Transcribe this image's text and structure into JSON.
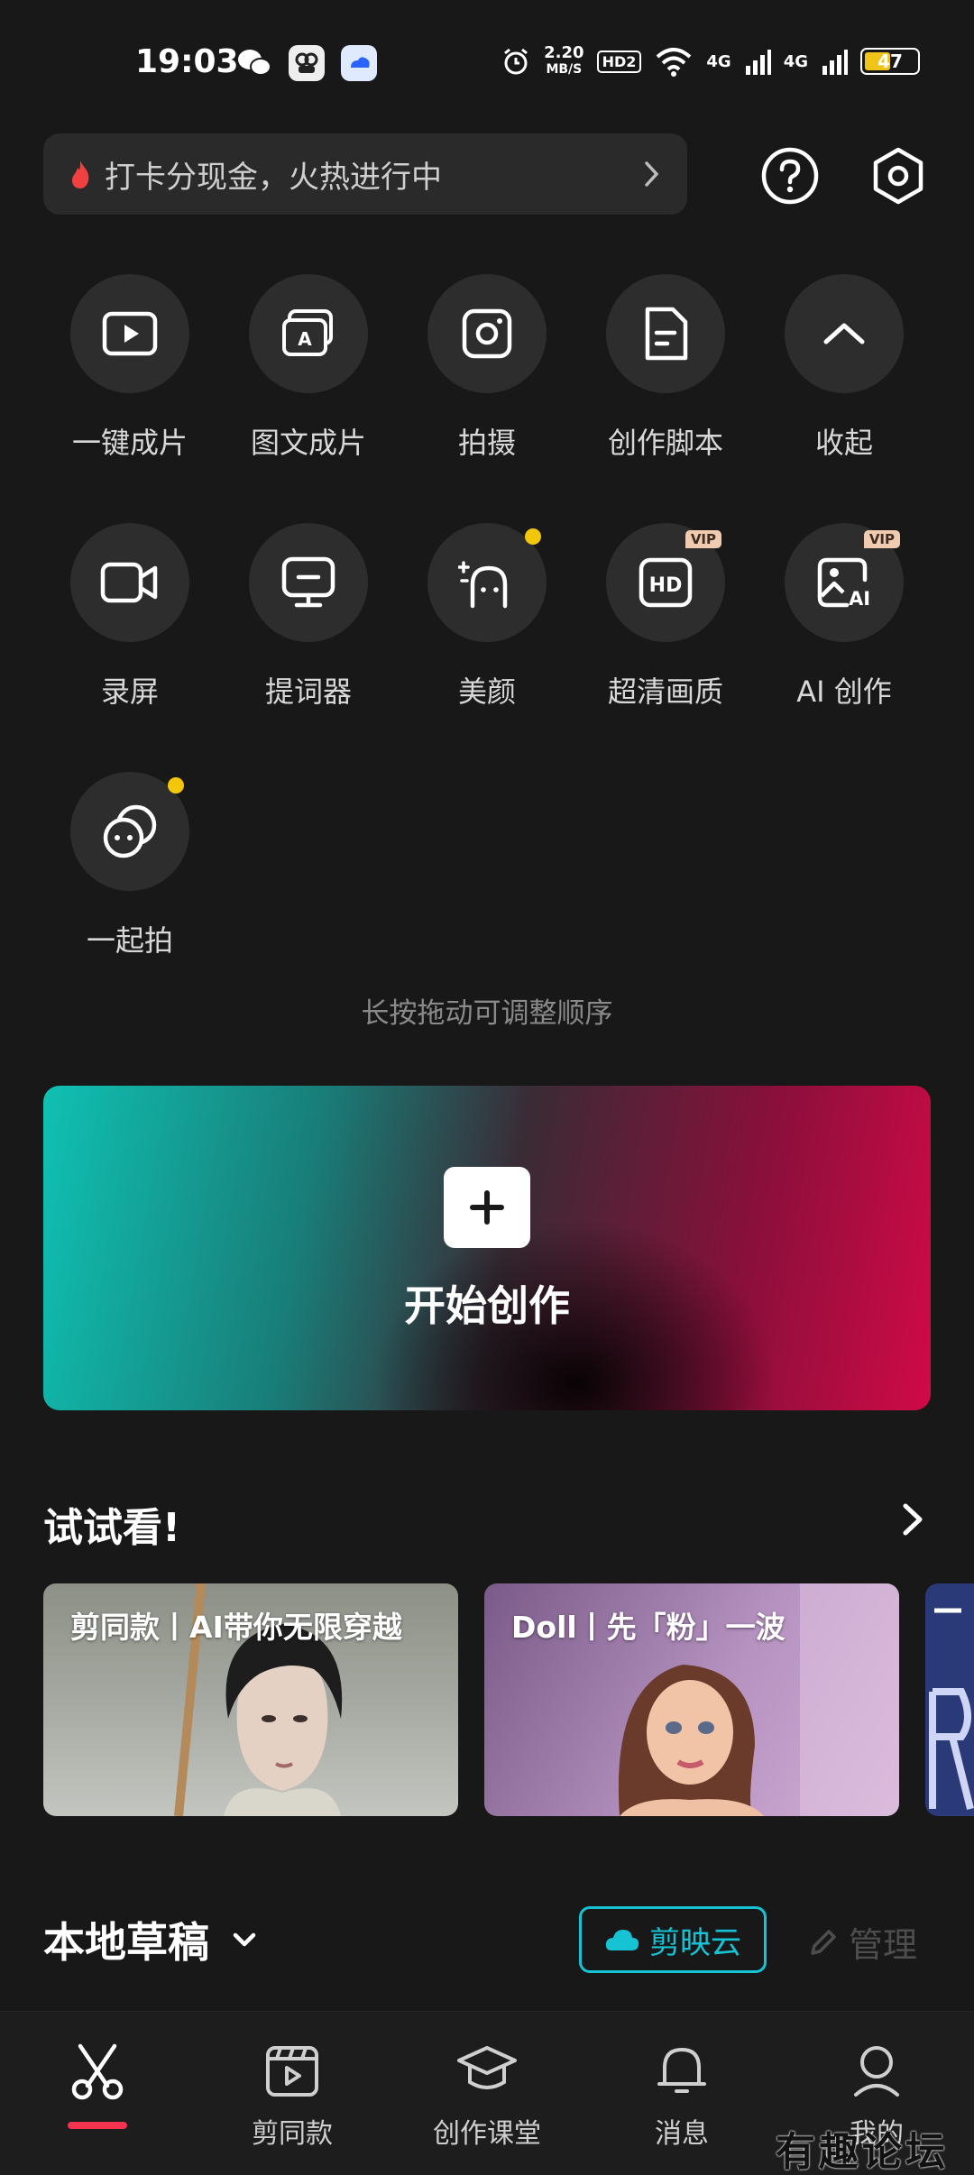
{
  "status_bar": {
    "time": "19:03",
    "net_speed_value": "2.20",
    "net_speed_unit": "MB/S",
    "hd_badge": "HD2",
    "signal_1": "4G",
    "signal_2": "4G",
    "battery": "47"
  },
  "promo": {
    "text": "打卡分现金，火热进行中"
  },
  "tools": [
    {
      "label": "一键成片",
      "icon": "play-square-icon"
    },
    {
      "label": "图文成片",
      "icon": "image-text-icon"
    },
    {
      "label": "拍摄",
      "icon": "camera-icon"
    },
    {
      "label": "创作脚本",
      "icon": "document-icon"
    },
    {
      "label": "收起",
      "icon": "chevron-up-icon"
    },
    {
      "label": "录屏",
      "icon": "video-camera-icon"
    },
    {
      "label": "提词器",
      "icon": "teleprompter-icon"
    },
    {
      "label": "美颜",
      "icon": "beauty-icon"
    },
    {
      "label": "超清画质",
      "icon": "hd-icon",
      "badge": "VIP"
    },
    {
      "label": "AI 创作",
      "icon": "ai-image-icon",
      "badge": "VIP"
    },
    {
      "label": "一起拍",
      "icon": "together-icon"
    }
  ],
  "hint": "长按拖动可调整顺序",
  "create": {
    "label": "开始创作"
  },
  "try_section": {
    "title": "试试看!",
    "cards": [
      {
        "title": "剪同款丨AI带你无限穿越"
      },
      {
        "title": "Doll丨先「粉」一波"
      }
    ]
  },
  "drafts": {
    "title": "本地草稿",
    "cloud_label": "剪映云",
    "manage_label": "管理"
  },
  "bottom_nav": [
    {
      "label": "",
      "icon": "scissors-icon",
      "active": true
    },
    {
      "label": "剪同款",
      "icon": "template-icon"
    },
    {
      "label": "创作课堂",
      "icon": "graduation-cap-icon"
    },
    {
      "label": "消息",
      "icon": "bell-icon"
    },
    {
      "label": "我的",
      "icon": "user-icon"
    }
  ],
  "watermark": "有趣论坛",
  "colors": {
    "background": "#181818",
    "accent_red": "#f5334f",
    "accent_cyan": "#16c3d4",
    "dot_yellow": "#f2c70a"
  }
}
